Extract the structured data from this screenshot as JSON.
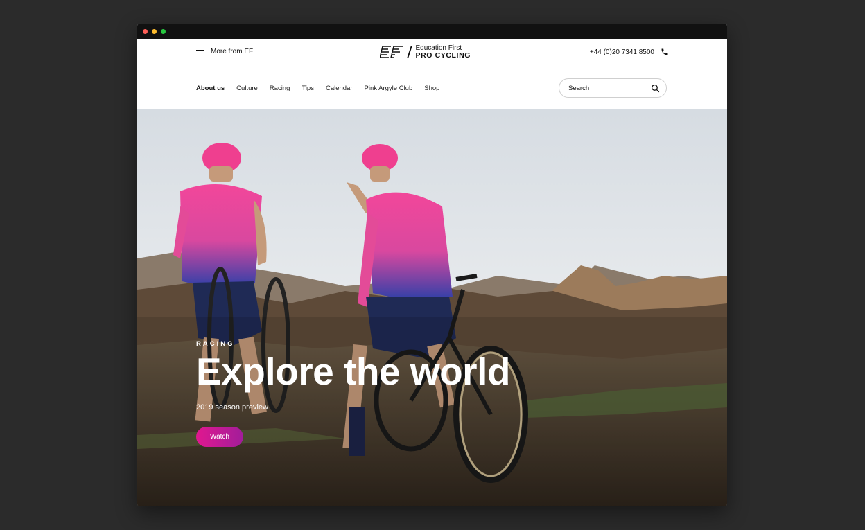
{
  "topbar": {
    "more_label": "More from EF",
    "logo_line1": "Education First",
    "logo_line2": "PRO CYCLING",
    "phone": "+44 (0)20 7341 8500"
  },
  "nav": {
    "items": [
      "About us",
      "Culture",
      "Racing",
      "Tips",
      "Calendar",
      "Pink Argyle Club",
      "Shop"
    ],
    "active": "About us"
  },
  "search": {
    "placeholder": "Search"
  },
  "hero": {
    "kicker": "RACING",
    "headline": "Explore the world",
    "subline": "2019 season preview",
    "cta": "Watch"
  },
  "colors": {
    "cta_start": "#e0188f",
    "cta_end": "#a21d9a",
    "jersey_pink": "#ef3f93",
    "jersey_blue": "#2d3fa8"
  },
  "icons": [
    "hamburger-icon",
    "ef-logo-mark",
    "phone-icon",
    "search-icon"
  ]
}
